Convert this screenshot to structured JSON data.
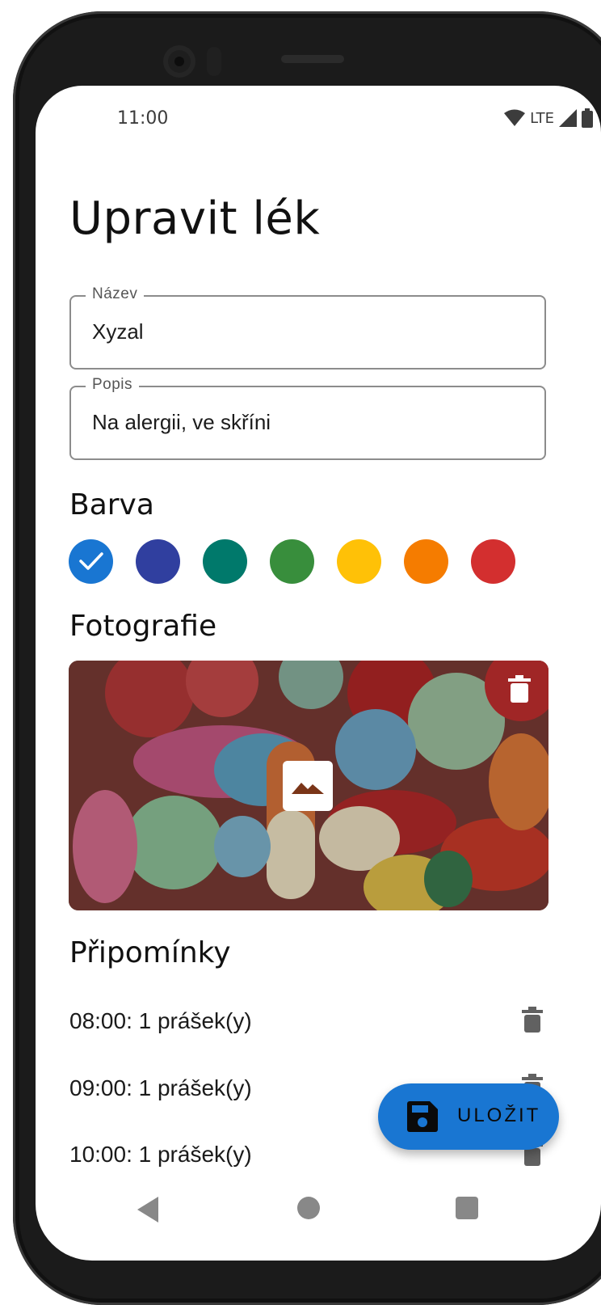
{
  "status_bar": {
    "time": "11:00",
    "network": "LTE"
  },
  "page": {
    "title": "Upravit lék"
  },
  "form": {
    "name": {
      "label": "Název",
      "value": "Xyzal"
    },
    "description": {
      "label": "Popis",
      "value": "Na alergii, ve skříni"
    }
  },
  "color_section": {
    "heading": "Barva",
    "swatches": [
      {
        "color": "#1976d2",
        "selected": true
      },
      {
        "color": "#303f9f",
        "selected": false
      },
      {
        "color": "#00796b",
        "selected": false
      },
      {
        "color": "#388e3c",
        "selected": false
      },
      {
        "color": "#ffc107",
        "selected": false
      },
      {
        "color": "#f57c00",
        "selected": false
      },
      {
        "color": "#d32f2f",
        "selected": false
      }
    ]
  },
  "photo_section": {
    "heading": "Fotografie",
    "icons": [
      "trash-icon",
      "image-icon"
    ]
  },
  "reminders": {
    "heading": "Připomínky",
    "items": [
      {
        "text": "08:00: 1 prášek(y)"
      },
      {
        "text": "09:00: 1 prášek(y)"
      },
      {
        "text": "10:00: 1 prášek(y)"
      }
    ]
  },
  "fab": {
    "label": "ULOŽIT",
    "icon": "save-icon"
  },
  "colors": {
    "accent": "#1976d2",
    "text": "#111111"
  }
}
